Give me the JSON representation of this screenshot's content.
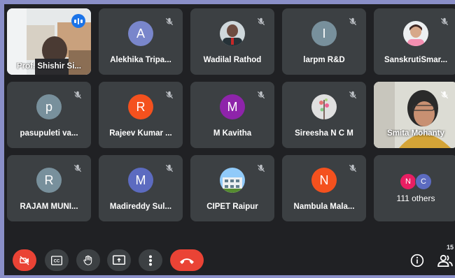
{
  "participants": [
    {
      "name": "Prof. Shishir Si...",
      "kind": "video",
      "speaking": true
    },
    {
      "name": "Alekhika Tripa...",
      "initial": "A",
      "color": "#7986cb"
    },
    {
      "name": "Wadilal Rathod",
      "kind": "photo"
    },
    {
      "name": "larpm R&D",
      "initial": "I",
      "color": "#78909c"
    },
    {
      "name": "SanskrutiSmar...",
      "kind": "photo"
    },
    {
      "name": "pasupuleti va...",
      "initial": "p",
      "color": "#78909c"
    },
    {
      "name": "Rajeev Kumar ...",
      "initial": "R",
      "color": "#f4511e"
    },
    {
      "name": "M Kavitha",
      "initial": "M",
      "color": "#8e24aa"
    },
    {
      "name": "Sireesha N C M",
      "kind": "photo"
    },
    {
      "name": "Smita Mohanty",
      "kind": "video"
    },
    {
      "name": "RAJAM MUNI...",
      "initial": "R",
      "color": "#78909c"
    },
    {
      "name": "Madireddy Sul...",
      "initial": "M",
      "color": "#5c6bc0"
    },
    {
      "name": "CIPET Raipur",
      "kind": "photo"
    },
    {
      "name": "Nambula Mala...",
      "initial": "N",
      "color": "#f4511e"
    }
  ],
  "others": {
    "label": "111 others",
    "avatars": [
      {
        "initial": "N",
        "color": "#e91e63"
      },
      {
        "initial": "C",
        "color": "#5c6bc0"
      }
    ]
  },
  "controls": {
    "participants_count": "15",
    "accent": "#ea4335"
  }
}
